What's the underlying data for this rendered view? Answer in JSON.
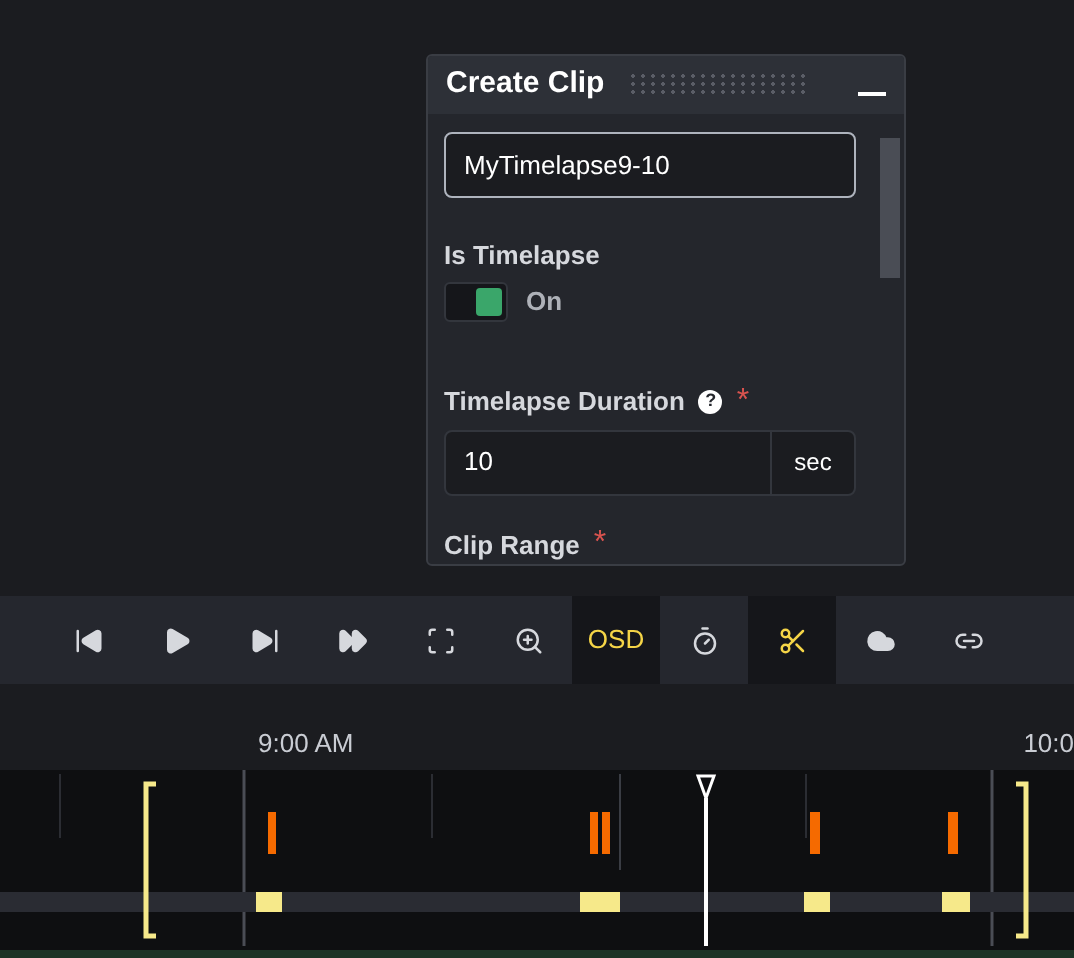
{
  "dialog": {
    "title": "Create Clip",
    "name_value": "MyTimelapse9-10",
    "is_timelapse": {
      "label": "Is Timelapse",
      "on": true,
      "state_text": "On"
    },
    "duration": {
      "label": "Timelapse Duration",
      "help": "?",
      "required_mark": "*",
      "value": "10",
      "unit": "sec"
    },
    "clip_range": {
      "label": "Clip Range",
      "required_mark": "*"
    }
  },
  "toolbar": [
    {
      "kind": "prev",
      "active": false
    },
    {
      "kind": "play",
      "active": false
    },
    {
      "kind": "next",
      "active": false
    },
    {
      "kind": "fast",
      "active": false
    },
    {
      "kind": "fullscreen",
      "active": false
    },
    {
      "kind": "zoom",
      "active": false
    },
    {
      "kind": "text",
      "label": "OSD",
      "active": true
    },
    {
      "kind": "timer",
      "active": false
    },
    {
      "kind": "scissors",
      "active": true
    },
    {
      "kind": "cloud",
      "active": false
    },
    {
      "kind": "link",
      "active": false
    }
  ],
  "timeline": {
    "labels": [
      "9:00 AM",
      "10:0"
    ]
  }
}
